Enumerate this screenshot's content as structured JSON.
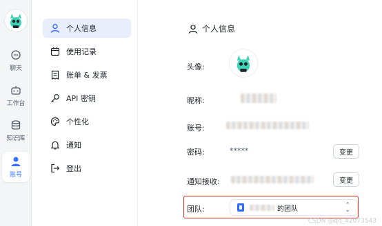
{
  "rail": {
    "items": [
      {
        "label": "聊天",
        "icon": "chat-icon"
      },
      {
        "label": "工作台",
        "icon": "robot-icon"
      },
      {
        "label": "知识库",
        "icon": "database-icon"
      },
      {
        "label": "账号",
        "icon": "user-icon"
      }
    ],
    "active": "账号"
  },
  "nav": {
    "items": [
      {
        "label": "个人信息",
        "icon": "user-icon"
      },
      {
        "label": "使用记录",
        "icon": "calendar-icon"
      },
      {
        "label": "账单 & 发票",
        "icon": "receipt-icon"
      },
      {
        "label": "API 密钥",
        "icon": "key-icon"
      },
      {
        "label": "个性化",
        "icon": "palette-icon"
      },
      {
        "label": "通知",
        "icon": "bell-icon"
      },
      {
        "label": "登出",
        "icon": "logout-icon"
      }
    ],
    "active": "个人信息"
  },
  "main": {
    "title": "个人信息",
    "rows": {
      "avatar_label": "头像:",
      "nickname_label": "昵称:",
      "account_label": "账号:",
      "password_label": "密码:",
      "password_value": "*****",
      "notify_label": "通知接收:",
      "team_label": "团队:"
    },
    "change_button": "变更",
    "team_name": "的团队"
  },
  "watermark": "CSDN @qq_42073543",
  "colors": {
    "accent": "#3370ff",
    "nav_active_bg": "#e8eefc",
    "highlight_border": "#e0302a"
  }
}
